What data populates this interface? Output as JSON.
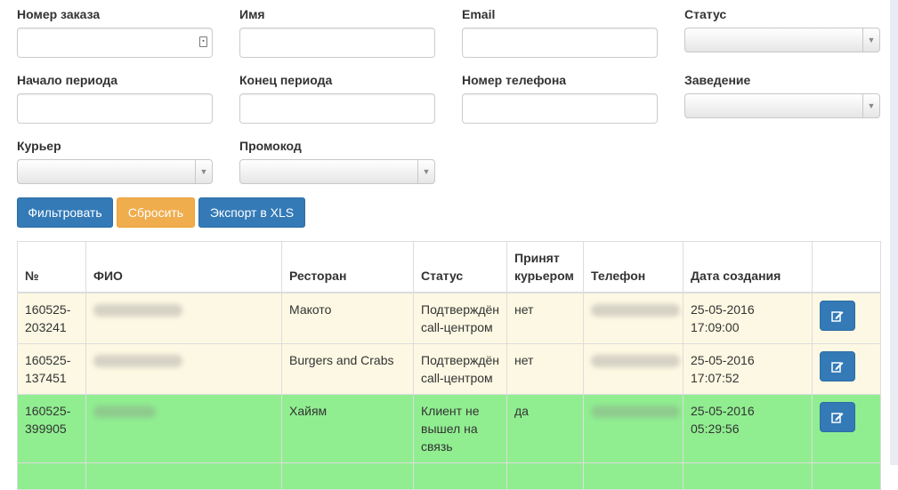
{
  "filters": {
    "order_number_label": "Номер заказа",
    "name_label": "Имя",
    "email_label": "Email",
    "status_label": "Статус",
    "period_start_label": "Начало периода",
    "period_end_label": "Конец периода",
    "phone_label": "Номер телефона",
    "venue_label": "Заведение",
    "courier_label": "Курьер",
    "promo_label": "Промокод"
  },
  "buttons": {
    "filter": "Фильтровать",
    "reset": "Сбросить",
    "export": "Экспорт в XLS"
  },
  "table": {
    "headers": {
      "num": "№",
      "fio": "ФИО",
      "restaurant": "Ресторан",
      "status": "Статус",
      "courier_accepted": "Принят курьером",
      "phone": "Телефон",
      "created": "Дата создания"
    },
    "rows": [
      {
        "num": "160525-203241",
        "restaurant": "Макото",
        "status": "Подтверждён call-центром",
        "courier": "нет",
        "created": "25-05-2016 17:09:00",
        "color": "#fcf8e3"
      },
      {
        "num": "160525-137451",
        "restaurant": "Burgers and Crabs",
        "status": "Подтверждён call-центром",
        "courier": "нет",
        "created": "25-05-2016 17:07:52",
        "color": "#fcf8e3"
      },
      {
        "num": "160525-399905",
        "restaurant": "Хайям",
        "status": "Клиент не вышел на связь",
        "courier": "да",
        "created": "25-05-2016 05:29:56",
        "color": "#90ee90"
      }
    ]
  },
  "icons": {
    "edit": "edit-icon",
    "calendar": "calendar-icon",
    "dropdown": "chevron-down-icon"
  }
}
